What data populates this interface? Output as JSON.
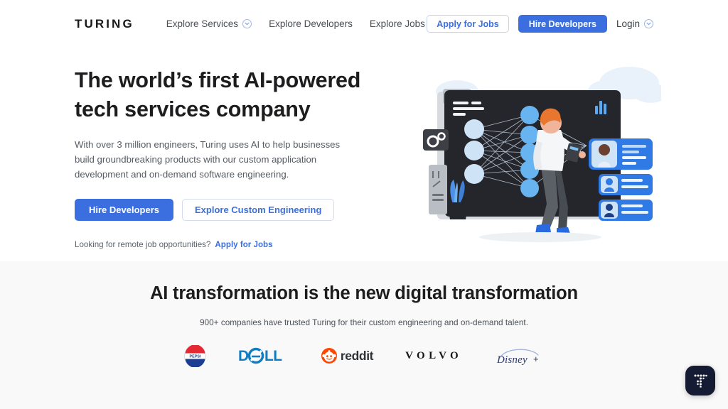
{
  "brand": {
    "logo_text": "TURING"
  },
  "colors": {
    "primary_blue": "#3b6fe0",
    "link_blue": "#3a6fe0",
    "text_dark": "#1d1d1f",
    "text_muted": "#555b63",
    "section_bg": "#f9f9f9",
    "fab_bg": "#141b33"
  },
  "nav": {
    "links": [
      {
        "label": "Explore Services",
        "has_dropdown": true,
        "icon": "chevron-down-circle-icon"
      },
      {
        "label": "Explore Developers",
        "has_dropdown": false
      },
      {
        "label": "Explore Jobs",
        "has_dropdown": false
      }
    ],
    "apply_button": "Apply for Jobs",
    "hire_button": "Hire Developers",
    "login_label": "Login",
    "login_icon": "chevron-down-circle-icon"
  },
  "hero": {
    "title": "The world’s first AI-powered tech services company",
    "subtitle": "With over 3 million engineers, Turing uses AI to help businesses build groundbreaking products with our custom application development and on-demand software engineering.",
    "primary_cta": "Hire Developers",
    "secondary_cta": "Explore Custom Engineering",
    "note_text": "Looking for remote job opportunities?",
    "note_link": "Apply for Jobs",
    "illustration_alt": "neural-network-board-illustration"
  },
  "section": {
    "heading": "AI transformation is the new digital transformation",
    "subheading": "900+ companies have trusted Turing for their custom engineering and on-demand talent.",
    "logos": [
      {
        "name": "pepsi",
        "label": "PEPSI"
      },
      {
        "name": "dell",
        "label": "D∕LL"
      },
      {
        "name": "reddit",
        "label": "reddit"
      },
      {
        "name": "volvo",
        "label": "VOLVO"
      },
      {
        "name": "disney-plus",
        "label": "Disney+"
      }
    ]
  },
  "chat_widget": {
    "icon": "turing-logo-icon",
    "label": "T"
  }
}
